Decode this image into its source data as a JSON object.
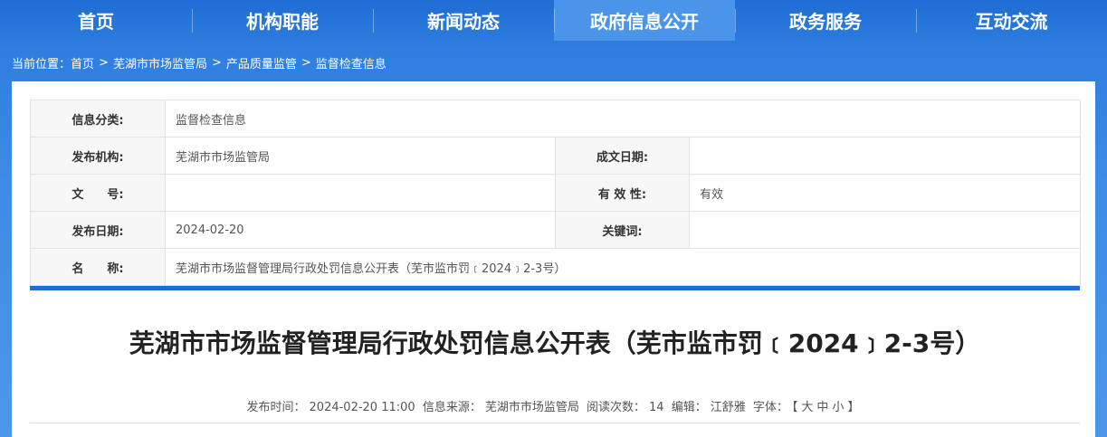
{
  "nav": {
    "items": [
      "首页",
      "机构职能",
      "新闻动态",
      "政府信息公开",
      "政务服务",
      "互动交流"
    ],
    "active_index": 3
  },
  "breadcrumb": {
    "prefix": "当前位置：",
    "items": [
      "首页",
      "芜湖市市场监管局",
      "产品质量监管",
      "监督检查信息"
    ],
    "separator": ">"
  },
  "info": {
    "category_label": "信息分类:",
    "category_value": "监督检查信息",
    "publisher_label": "发布机构:",
    "publisher_value": "芜湖市市场监管局",
    "written_date_label": "成文日期:",
    "written_date_value": "",
    "doc_no_label": "文　　号:",
    "doc_no_value": "",
    "validity_label": "有 效 性:",
    "validity_value": "有效",
    "publish_date_label": "发布日期:",
    "publish_date_value": "2024-02-20",
    "keywords_label": "关键词:",
    "keywords_value": "",
    "name_label": "名　　称:",
    "name_value": "芜湖市市场监督管理局行政处罚信息公开表（芜市监市罚﹝2024﹞2-3号）"
  },
  "article": {
    "title": "芜湖市市场监督管理局行政处罚信息公开表（芜市监市罚﹝2024﹞2-3号）",
    "meta": {
      "publish_time_label": "发布时间：",
      "publish_time": "2024-02-20 11:00",
      "source_label": "信息来源：",
      "source": "芜湖市市场监管局",
      "views_label": "阅读次数：",
      "views": "14",
      "editor_label": "编辑：",
      "editor": "江舒雅",
      "font_label": "字体：",
      "font_open": "【",
      "font_large": "大",
      "font_medium": "中",
      "font_small": "小",
      "font_close": "】"
    }
  },
  "colors": {
    "nav_bg": "#1f6dd4",
    "nav_active": "#4a94ea",
    "accent_bar": "#1f6dd4"
  }
}
